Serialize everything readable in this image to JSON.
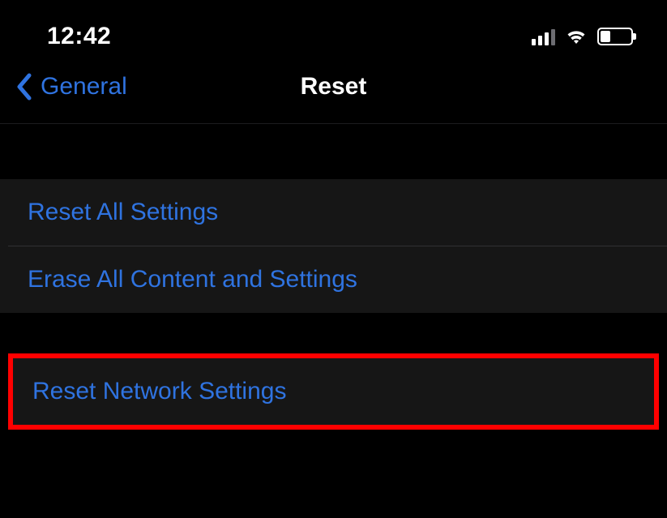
{
  "status_bar": {
    "time": "12:42",
    "signal_bars_active": 3,
    "signal_bars_total": 4,
    "wifi_strength": 3,
    "battery_percent": 35
  },
  "nav": {
    "back_label": "General",
    "title": "Reset"
  },
  "sections": {
    "group1": {
      "reset_all": "Reset All Settings",
      "erase_all": "Erase All Content and Settings"
    },
    "group2": {
      "reset_network": "Reset Network Settings"
    }
  },
  "colors": {
    "accent_blue": "#2f73e0",
    "highlight_red": "#ff0000",
    "background": "#000000",
    "row_background": "#161616"
  }
}
